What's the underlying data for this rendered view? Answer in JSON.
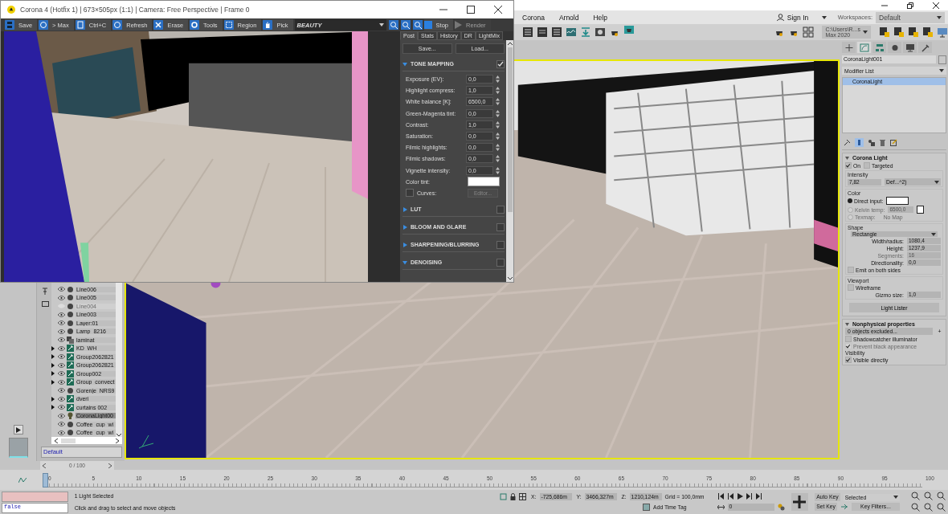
{
  "max_window": {
    "menus": [
      {
        "label": "Corona"
      },
      {
        "label": "Arnold"
      },
      {
        "label": "Help"
      }
    ],
    "sign_in": "Sign In",
    "workspaces_label": "Workspaces:",
    "workspace": "Default",
    "project_path": "C:\\Users\\R...s Max 2020"
  },
  "corona_window": {
    "title": "Corona 4 (Hotfix 1) | 673×505px (1:1) | Camera: Free Perspective | Frame 0",
    "toolbar": [
      {
        "label": "Save",
        "kind": "save",
        "disabled": false
      },
      {
        "label": "> Max",
        "kind": "max",
        "disabled": false
      },
      {
        "label": "Ctrl+C",
        "kind": "copy",
        "disabled": false
      },
      {
        "label": "Refresh",
        "kind": "refresh",
        "disabled": false
      },
      {
        "label": "Erase",
        "kind": "erase",
        "disabled": false
      },
      {
        "label": "Tools",
        "kind": "tools",
        "disabled": false
      },
      {
        "label": "Region",
        "kind": "region",
        "disabled": false
      },
      {
        "label": "Pick",
        "kind": "pick",
        "disabled": false
      }
    ],
    "channel": "BEAUTY",
    "render_buttons": [
      {
        "label": "Stop",
        "kind": "stop",
        "disabled": false
      },
      {
        "label": "Render",
        "kind": "render",
        "disabled": true
      }
    ],
    "tabs": [
      {
        "label": "Post",
        "selected": true
      },
      {
        "label": "Stats",
        "selected": false
      },
      {
        "label": "History",
        "selected": false
      },
      {
        "label": "DR",
        "selected": false
      },
      {
        "label": "LightMix",
        "selected": false
      }
    ],
    "save_button": "Save...",
    "load_button": "Load...",
    "sections": [
      {
        "title": "TONE MAPPING",
        "expanded": true,
        "checked": true
      },
      {
        "title": "LUT",
        "expanded": false,
        "checked": false
      },
      {
        "title": "BLOOM AND GLARE",
        "expanded": false,
        "checked": false
      },
      {
        "title": "SHARPENING/BLURRING",
        "expanded": false,
        "checked": false
      },
      {
        "title": "DENOISING",
        "expanded": true,
        "checked": false
      }
    ],
    "params": [
      {
        "label": "Exposure (EV):",
        "value": "0,0"
      },
      {
        "label": "Highlight compress:",
        "value": "1,0"
      },
      {
        "label": "White balance [K]:",
        "value": "6500,0"
      },
      {
        "label": "Green-Magenta tint:",
        "value": "0,0"
      },
      {
        "label": "Contrast:",
        "value": "1,0"
      },
      {
        "label": "Saturation:",
        "value": "0,0"
      },
      {
        "label": "Filmic highlights:",
        "value": "0,0"
      },
      {
        "label": "Filmic shadows:",
        "value": "0,0"
      },
      {
        "label": "Vignette intensity:",
        "value": "0,0"
      }
    ],
    "color_tint_label": "Color tint:",
    "curves": {
      "label": "Curves:",
      "checked": false
    },
    "editor_button": "Editor..."
  },
  "scene_explorer": {
    "items": [
      {
        "name": "Line006",
        "kind": "object",
        "visible": true,
        "selected": false,
        "expandable": false
      },
      {
        "name": "Line005",
        "kind": "object",
        "visible": true,
        "selected": false,
        "expandable": false
      },
      {
        "name": "Line004",
        "kind": "object",
        "visible": false,
        "selected": false,
        "expandable": false
      },
      {
        "name": "Line003",
        "kind": "object",
        "visible": true,
        "selected": false,
        "expandable": false
      },
      {
        "name": "Layer:01",
        "kind": "object",
        "visible": true,
        "selected": false,
        "expandable": false
      },
      {
        "name": "Lamp_8216",
        "kind": "object",
        "visible": true,
        "selected": false,
        "expandable": false
      },
      {
        "name": "laminat",
        "kind": "layer",
        "visible": true,
        "selected": false,
        "expandable": false
      },
      {
        "name": "KD_WH",
        "kind": "group",
        "visible": true,
        "selected": false,
        "expandable": true
      },
      {
        "name": "Group2062821",
        "kind": "group",
        "visible": true,
        "selected": false,
        "expandable": true
      },
      {
        "name": "Group2062821",
        "kind": "group",
        "visible": true,
        "selected": false,
        "expandable": true
      },
      {
        "name": "Group002",
        "kind": "group",
        "visible": true,
        "selected": false,
        "expandable": true
      },
      {
        "name": "Group_convect",
        "kind": "group",
        "visible": true,
        "selected": false,
        "expandable": true
      },
      {
        "name": "Gorenje_NRS9",
        "kind": "object",
        "visible": true,
        "selected": false,
        "expandable": false
      },
      {
        "name": "dveri",
        "kind": "group",
        "visible": true,
        "selected": false,
        "expandable": true
      },
      {
        "name": "curtains 002",
        "kind": "group",
        "visible": true,
        "selected": false,
        "expandable": true
      },
      {
        "name": "CoronaLight00",
        "kind": "light",
        "visible": true,
        "selected": true,
        "expandable": false
      },
      {
        "name": "Coffee_cup_wi",
        "kind": "object",
        "visible": true,
        "selected": false,
        "expandable": false
      },
      {
        "name": "Coffee_cup_wi",
        "kind": "object",
        "visible": true,
        "selected": false,
        "expandable": false
      }
    ],
    "layer_field": "Default"
  },
  "command_panel": {
    "object_name": "CoronaLight001",
    "modifier_list": "Modifier List",
    "stack": [
      {
        "label": "CoronaLight",
        "selected": true
      }
    ],
    "rollout_title": "Corona Light",
    "on": {
      "label": "On",
      "checked": true
    },
    "targeted": {
      "label": "Targeted",
      "checked": false
    },
    "intensity_label": "Intensity",
    "intensity": "7,82",
    "intensity_unit": "Def...^2)",
    "color_label": "Color",
    "color_modes": [
      {
        "label": "Direct input:",
        "selected": true,
        "disabled": false
      },
      {
        "label": "Kelvin temp:",
        "selected": false,
        "disabled": true
      },
      {
        "label": "Texmap:",
        "selected": false,
        "disabled": true
      }
    ],
    "kelvin": "6500,0",
    "texmap": "No Map",
    "shape_label": "Shape",
    "shape": "Rectangle",
    "shape_params": [
      {
        "label": "Width/radius:",
        "value": "1080,4",
        "disabled": false
      },
      {
        "label": "Height:",
        "value": "1237,9",
        "disabled": false
      },
      {
        "label": "Segments:",
        "value": "16",
        "disabled": true
      },
      {
        "label": "Directionality:",
        "value": "0,0",
        "disabled": false
      }
    ],
    "emit_both": {
      "label": "Emit on both sides",
      "checked": false
    },
    "viewport_label": "Viewport",
    "wireframe": {
      "label": "Wireframe",
      "checked": false
    },
    "gizmo_label": "Gizmo size:",
    "gizmo": "1,0",
    "light_lister": "Light Lister",
    "nonphysical_title": "Nonphysical properties",
    "excluded": "0 objects excluded...",
    "add": "+",
    "shadowcatcher": {
      "label": "Shadowcatcher illuminator",
      "checked": false,
      "disabled": false
    },
    "prevent_black": {
      "label": "Prevent black appearance",
      "checked": true,
      "disabled": true
    },
    "visibility_label": "Visibility",
    "visible_directly": {
      "label": "Visible directly",
      "checked": true,
      "disabled": false
    }
  },
  "timeline": {
    "frame_range": "0 / 100",
    "ticks": [
      "0",
      "5",
      "10",
      "15",
      "20",
      "25",
      "30",
      "35",
      "40",
      "45",
      "50",
      "55",
      "60",
      "65",
      "70",
      "75",
      "80",
      "85",
      "90",
      "95",
      "100"
    ],
    "level": 0
  },
  "status_bar": {
    "listener": "false",
    "selection": "1 Light Selected",
    "prompt": "Click and drag to select and move objects",
    "x_label": "X:",
    "x": "-725,686m",
    "y_label": "Y:",
    "y": "3466,327m",
    "z_label": "Z:",
    "z": "1210,124m",
    "grid": "Grid = 100,0mm",
    "add_time_tag": "Add Time Tag",
    "auto_key": "Auto Key",
    "key_mode": "Selected",
    "set_key": "Set Key",
    "key_filters": "Key Filters...",
    "frame": "0"
  }
}
